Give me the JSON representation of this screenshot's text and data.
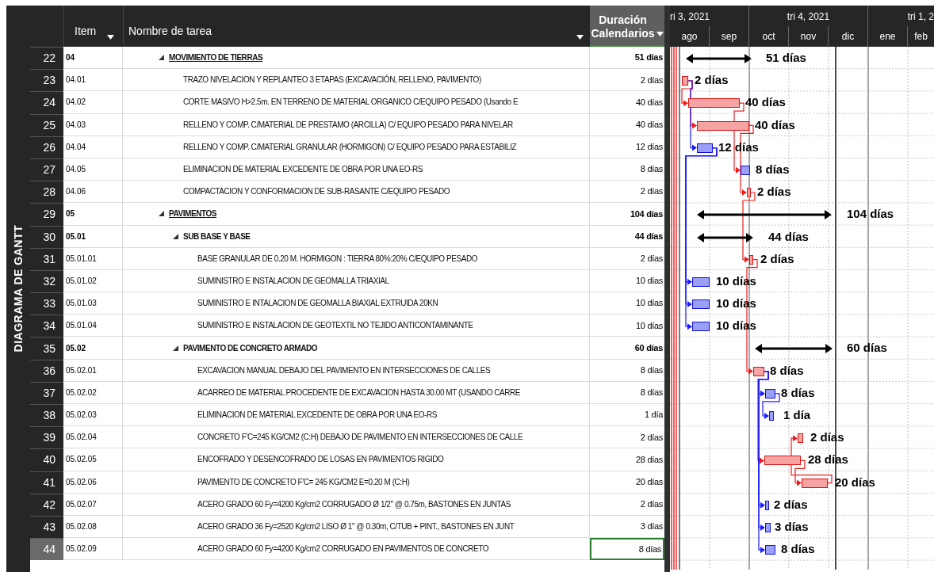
{
  "view_label": "DIAGRAMA DE GANTT",
  "columns": [
    {
      "label": "Item",
      "filter": true,
      "selected": false
    },
    {
      "label": "Nombre de tarea",
      "filter": true,
      "selected": false
    },
    {
      "label": "Duración Calendarios",
      "filter": true,
      "selected": true
    }
  ],
  "timescale": {
    "quarters": [
      "ri 3, 2021",
      "tri 4, 2021",
      "tri 1, 2"
    ],
    "months": [
      "ago",
      "sep",
      "oct",
      "nov",
      "dic",
      "ene",
      "feb"
    ]
  },
  "rows": [
    {
      "id": "22",
      "item": "04",
      "name": "MOVIMIENTO DE TIERRAS",
      "duration": "51 días",
      "selected": false,
      "expanded": true,
      "bar": {
        "kind": "summary",
        "label": "51 días"
      },
      "children": [
        {
          "id": "23",
          "item": "04.01",
          "name": "TRAZO NIVELACION Y REPLANTEO 3 ETAPAS (EXCAVACIÓN, RELLENO, PAVIMENTO)",
          "duration": "2 días",
          "selected": false,
          "bar": {
            "kind": "critical",
            "label": "2 días"
          }
        },
        {
          "id": "24",
          "item": "04.02",
          "name": "CORTE MASIVO H>2.5m. EN TERRENO DE MATERIAL ORGANICO C/EQUIPO PESADO (Usando E",
          "duration": "40 días",
          "selected": false,
          "bar": {
            "kind": "critical",
            "label": "40 días"
          }
        },
        {
          "id": "25",
          "item": "04.03",
          "name": "RELLENO Y COMP. C/MATERIAL DE PRESTAMO (ARCILLA) C/ EQUIPO PESADO PARA NIVELAR",
          "duration": "40 días",
          "selected": false,
          "bar": {
            "kind": "critical",
            "label": "40 días"
          }
        },
        {
          "id": "26",
          "item": "04.04",
          "name": "RELLENO Y COMP. C/MATERIAL GRANULAR (HORMIGON) C/ EQUIPO PESADO PARA ESTABILIZ",
          "duration": "12 días",
          "selected": false,
          "bar": {
            "kind": "normal",
            "label": "12 días"
          }
        },
        {
          "id": "27",
          "item": "04.05",
          "name": "ELIMINACION DE MATERIAL EXCEDENTE DE OBRA POR UNA EO-RS",
          "duration": "8 días",
          "selected": false,
          "bar": {
            "kind": "normal",
            "label": "8 días"
          }
        },
        {
          "id": "28",
          "item": "04.06",
          "name": "COMPACTACION Y CONFORMACION DE SUB-RASANTE C/EQUIPO PESADO",
          "duration": "2 días",
          "selected": false,
          "bar": {
            "kind": "critical",
            "label": "2 días"
          }
        }
      ]
    },
    {
      "id": "29",
      "item": "05",
      "name": "PAVIMENTOS",
      "duration": "104 días",
      "selected": false,
      "expanded": true,
      "bar": {
        "kind": "summary",
        "label": "104 días"
      },
      "children": [
        {
          "id": "30",
          "item": "05.01",
          "name": "SUB BASE Y BASE",
          "duration": "44 días",
          "selected": false,
          "expanded": true,
          "bar": {
            "kind": "summary",
            "label": "44 días"
          },
          "children": [
            {
              "id": "31",
              "item": "05.01.01",
              "name": "BASE GRANULAR DE 0.20 M. HORMIGON : TIERRA 80%:20% C/EQUIPO PESADO",
              "duration": "2 días",
              "selected": false,
              "bar": {
                "kind": "critical",
                "label": "2 días"
              }
            },
            {
              "id": "32",
              "item": "05.01.02",
              "name": "SUMINISTRO E INSTALACION DE GEOMALLA TRIAXIAL",
              "duration": "10 días",
              "selected": false,
              "bar": {
                "kind": "normal",
                "label": "10 días"
              }
            },
            {
              "id": "33",
              "item": "05.01.03",
              "name": "SUMINISTRO E INTALACION DE GEOMALLA BIAXIAL EXTRUIDA 20KN",
              "duration": "10 días",
              "selected": false,
              "bar": {
                "kind": "normal",
                "label": "10 días"
              }
            },
            {
              "id": "34",
              "item": "05.01.04",
              "name": "SUMINISTRO E INSTALACION DE GEOTEXTIL NO TEJIDO ANTICONTAMINANTE",
              "duration": "10 días",
              "selected": false,
              "bar": {
                "kind": "normal",
                "label": "10 días"
              }
            }
          ]
        },
        {
          "id": "35",
          "item": "05.02",
          "name": "PAVIMENTO DE CONCRETO ARMADO",
          "duration": "60 días",
          "selected": false,
          "expanded": true,
          "bar": {
            "kind": "summary",
            "label": "60 días"
          },
          "children": [
            {
              "id": "36",
              "item": "05.02.01",
              "name": "EXCAVACION MANUAL DEBAJO DEL PAVIMENTO EN INTERSECCIONES DE CALLES",
              "duration": "8 días",
              "selected": false,
              "bar": {
                "kind": "critical",
                "label": "8 días"
              }
            },
            {
              "id": "37",
              "item": "05.02.02",
              "name": "ACARREO DE MATERIAL PROCEDENTE DE EXCAVACION HASTA 30.00 MT (USANDO CARRE",
              "duration": "8 días",
              "selected": false,
              "bar": {
                "kind": "normal",
                "label": "8 días"
              }
            },
            {
              "id": "38",
              "item": "05.02.03",
              "name": "ELIMINACION DE MATERIAL EXCEDENTE DE OBRA POR UNA EO-RS",
              "duration": "1 día",
              "selected": false,
              "bar": {
                "kind": "normal",
                "label": "1 día"
              }
            },
            {
              "id": "39",
              "item": "05.02.04",
              "name": "CONCRETO F'C=245 KG/CM2 (C:H) DEBAJO DE PAVIMENTO EN INTERSECCIONES DE CALLE",
              "duration": "2 días",
              "selected": false,
              "bar": {
                "kind": "critical",
                "label": "2 días"
              }
            },
            {
              "id": "40",
              "item": "05.02.05",
              "name": "ENCOFRADO Y DESENCOFRADO DE LOSAS EN PAVIMENTOS RIGIDO",
              "duration": "28 días",
              "selected": false,
              "bar": {
                "kind": "critical",
                "label": "28 días"
              }
            },
            {
              "id": "41",
              "item": "05.02.06",
              "name": "PAVIMENTO DE CONCRETO F'C= 245 KG/CM2 E=0.20 M (C:H)",
              "duration": "20 días",
              "selected": false,
              "bar": {
                "kind": "critical",
                "label": "20 días"
              }
            },
            {
              "id": "42",
              "item": "05.02.07",
              "name": "ACERO GRADO 60  Fy=4200 Kg/cm2 CORRUGADO Ø 1/2\" @ 0.75m, BASTONES EN JUNTAS",
              "duration": "2 días",
              "selected": false,
              "bar": {
                "kind": "normal",
                "label": "2 días"
              }
            },
            {
              "id": "43",
              "item": "05.02.08",
              "name": "ACERO GRADO 36  Fy=2520 Kg/cm2 LISO Ø 1\" @ 0.30m, C/TUB + PINT., BASTONES EN JUNT",
              "duration": "3 días",
              "selected": false,
              "bar": {
                "kind": "normal",
                "label": "3 días"
              }
            },
            {
              "id": "44",
              "item": "05.02.09",
              "name": "ACERO GRADO 60  Fy=4200 Kg/cm2 CORRUGADO EN PAVIMENTOS DE CONCRETO",
              "duration": "8 días",
              "selected": true,
              "bar": {
                "kind": "normal",
                "label": "8 días"
              }
            }
          ]
        }
      ]
    }
  ]
}
